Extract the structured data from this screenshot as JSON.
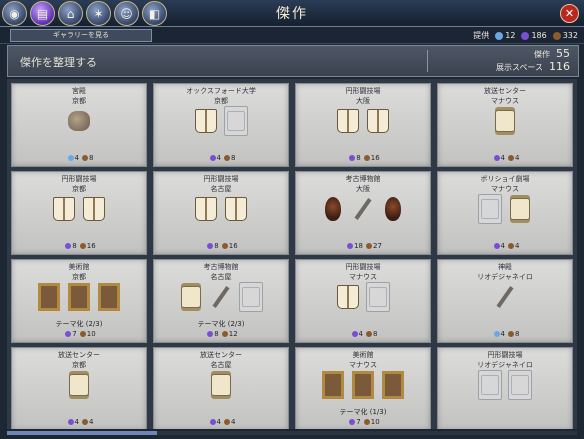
{
  "title": "傑作",
  "close_icon": "close-icon",
  "tabs": [
    {
      "icon": "globe-icon",
      "glyph": "◉"
    },
    {
      "icon": "book-icon",
      "glyph": "▤"
    },
    {
      "icon": "temple-icon",
      "glyph": "⌂"
    },
    {
      "icon": "religion-icon",
      "glyph": "✶"
    },
    {
      "icon": "leader-icon",
      "glyph": "☺"
    },
    {
      "icon": "policy-icon",
      "glyph": "◧"
    }
  ],
  "gallery_button": "ギャラリーを見る",
  "supply": {
    "label": "提供",
    "values": [
      "12",
      "186",
      "332"
    ]
  },
  "header": {
    "organize": "傑作を整理する",
    "masterpieces_label": "傑作",
    "masterpieces_value": "55",
    "exhibit_label": "展示スペース",
    "exhibit_value": "116"
  },
  "colors": {
    "culture": "#7a4ed3",
    "tourism": "#8b5a2f",
    "faith": "#6ca7e3"
  },
  "cards": [
    {
      "name": "宮殿",
      "city": "京都",
      "slots": [
        "vessel"
      ],
      "y1": "4",
      "y2": "8",
      "y1kind": "faith",
      "theme": ""
    },
    {
      "name": "オックスフォード大学",
      "city": "京都",
      "slots": [
        "book",
        "empty"
      ],
      "y1": "4",
      "y2": "8",
      "y1kind": "culture",
      "theme": ""
    },
    {
      "name": "円形闘技場",
      "city": "大阪",
      "slots": [
        "book",
        "book"
      ],
      "y1": "8",
      "y2": "16",
      "y1kind": "culture",
      "theme": ""
    },
    {
      "name": "放送センター",
      "city": "マナウス",
      "slots": [
        "scroll"
      ],
      "y1": "4",
      "y2": "4",
      "y1kind": "culture",
      "theme": ""
    },
    {
      "name": "円形闘技場",
      "city": "京都",
      "slots": [
        "book",
        "book"
      ],
      "y1": "8",
      "y2": "16",
      "y1kind": "culture",
      "theme": ""
    },
    {
      "name": "円形闘技場",
      "city": "名古屋",
      "slots": [
        "book",
        "book"
      ],
      "y1": "8",
      "y2": "16",
      "y1kind": "culture",
      "theme": ""
    },
    {
      "name": "考古博物館",
      "city": "大阪",
      "slots": [
        "mask",
        "staff",
        "mask"
      ],
      "y1": "18",
      "y2": "27",
      "y1kind": "culture",
      "theme": ""
    },
    {
      "name": "ボリショイ劇場",
      "city": "マナウス",
      "slots": [
        "empty",
        "scroll"
      ],
      "y1": "4",
      "y2": "4",
      "y1kind": "culture",
      "theme": ""
    },
    {
      "name": "美術館",
      "city": "京都",
      "slots": [
        "painting",
        "painting",
        "painting"
      ],
      "y1": "7",
      "y2": "10",
      "y1kind": "culture",
      "theme": "テーマ化 (2/3)"
    },
    {
      "name": "考古博物館",
      "city": "名古屋",
      "slots": [
        "scroll",
        "staff",
        "empty"
      ],
      "y1": "8",
      "y2": "12",
      "y1kind": "culture",
      "theme": "テーマ化 (2/3)"
    },
    {
      "name": "円形闘技場",
      "city": "マナウス",
      "slots": [
        "book",
        "empty"
      ],
      "y1": "4",
      "y2": "8",
      "y1kind": "culture",
      "theme": ""
    },
    {
      "name": "神殿",
      "city": "リオデジャネイロ",
      "slots": [
        "staff"
      ],
      "y1": "4",
      "y2": "8",
      "y1kind": "faith",
      "theme": ""
    },
    {
      "name": "放送センター",
      "city": "京都",
      "slots": [
        "scroll"
      ],
      "y1": "4",
      "y2": "4",
      "y1kind": "culture",
      "theme": ""
    },
    {
      "name": "放送センター",
      "city": "名古屋",
      "slots": [
        "scroll"
      ],
      "y1": "4",
      "y2": "4",
      "y1kind": "culture",
      "theme": ""
    },
    {
      "name": "美術館",
      "city": "マナウス",
      "slots": [
        "painting",
        "painting",
        "painting"
      ],
      "y1": "7",
      "y2": "10",
      "y1kind": "culture",
      "theme": "テーマ化 (1/3)"
    },
    {
      "name": "円形闘技場",
      "city": "リオデジャネイロ",
      "slots": [
        "empty",
        "empty"
      ],
      "y1": "",
      "y2": "",
      "y1kind": "culture",
      "theme": ""
    }
  ]
}
